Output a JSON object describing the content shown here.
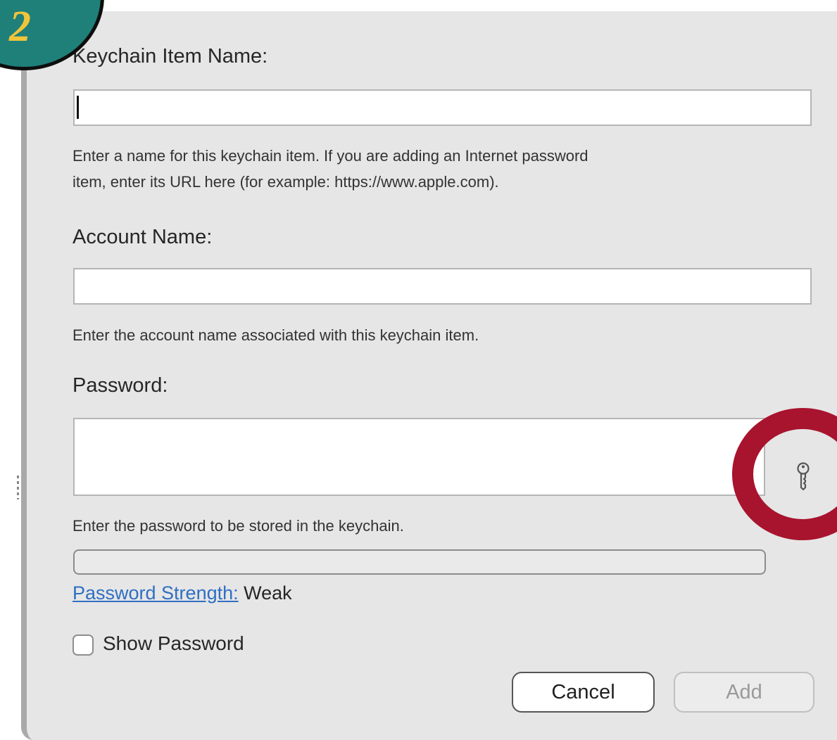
{
  "step_badge": {
    "number": "2"
  },
  "dialog": {
    "keychain_item_name": {
      "label": "Keychain Item Name:",
      "value": "",
      "help_line1": "Enter a name for this keychain item. If you are adding an Internet password",
      "help_line2": "item, enter its URL here (for example: https://www.apple.com)."
    },
    "account_name": {
      "label": "Account Name:",
      "value": "",
      "help": "Enter the account name associated with this keychain item."
    },
    "password": {
      "label": "Password:",
      "value": "",
      "help": "Enter the password to be stored in the keychain.",
      "assistant_icon": "key-icon"
    },
    "strength": {
      "link": "Password Strength:",
      "value": "Weak",
      "fill_fraction": 0
    },
    "show_password": {
      "label": "Show Password",
      "checked": false
    },
    "buttons": {
      "cancel": "Cancel",
      "add": "Add"
    }
  },
  "colors": {
    "highlight_ring": "#a8132e",
    "badge_fill": "#1f8079",
    "badge_number": "#f0c53a",
    "link": "#2f6fc4"
  }
}
